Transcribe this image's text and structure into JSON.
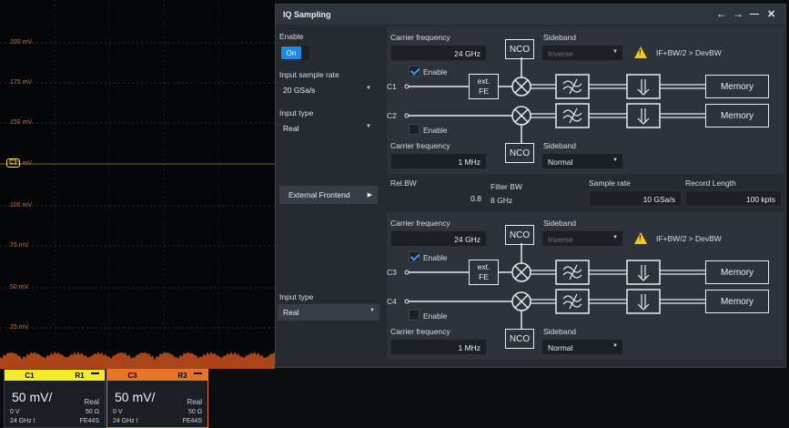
{
  "scope": {
    "y_labels": [
      "200 mV",
      "175 mV",
      "150 mV",
      "125 mV",
      "100 mV",
      "75 mV",
      "50 mV",
      "25 mV"
    ],
    "c1_marker": "C1"
  },
  "channels": [
    {
      "hdr_left": "C1",
      "hdr_right": "R1",
      "scale": "50 mV/",
      "mode": "Real",
      "offset": "0 V",
      "impedance": "50 Ω",
      "bandwidth": "24 GHz I",
      "probe": "FE44S",
      "color": "#f2ec2a"
    },
    {
      "hdr_left": "C3",
      "hdr_right": "R3",
      "scale": "50 mV/",
      "mode": "Real",
      "offset": "0 V",
      "impedance": "50 Ω",
      "bandwidth": "24 GHz I",
      "probe": "FE44S",
      "color": "#e8742a"
    }
  ],
  "dialog": {
    "title": "IQ Sampling",
    "btn_back": "←",
    "btn_fwd": "→",
    "btn_min": "—",
    "btn_close": "✕",
    "enable_label": "Enable",
    "toggle_on": "On",
    "input_sample_rate_label": "Input sample rate",
    "input_sample_rate": "20 GSa/s",
    "input_type_label": "Input type",
    "input_type_1": "Real",
    "input_type_2": "Real",
    "external_frontend": "External Frontend",
    "rel_bw_label": "Rel.BW",
    "rel_bw": "0.8",
    "filter_bw_label": "Filter BW",
    "filter_bw": "8 GHz",
    "sample_rate_label": "Sample rate",
    "sample_rate": "10 GSa/s",
    "record_length_label": "Record Length",
    "record_length": "100 kpts",
    "blocks": [
      {
        "carrier_top_label": "Carrier frequency",
        "carrier_top": "24 GHz",
        "sideband_top_label": "Sideband",
        "sideband_top": "Inverse",
        "warning": "IF+BW/2 > DevBW",
        "ch_a": "C1",
        "ch_a_enable": "Enable",
        "ch_a_checked": true,
        "ch_b": "C2",
        "ch_b_enable": "Enable",
        "ch_b_checked": false,
        "carrier_bot_label": "Carrier frequency",
        "carrier_bot": "1 MHz",
        "sideband_bot_label": "Sideband",
        "sideband_bot": "Normal",
        "nco": "NCO",
        "ext": "ext.",
        "fe": "FE",
        "memory": "Memory"
      },
      {
        "carrier_top_label": "Carrier frequency",
        "carrier_top": "24 GHz",
        "sideband_top_label": "Sideband",
        "sideband_top": "Inverse",
        "warning": "IF+BW/2 > DevBW",
        "ch_a": "C3",
        "ch_a_enable": "Enable",
        "ch_a_checked": true,
        "ch_b": "C4",
        "ch_b_enable": "Enable",
        "ch_b_checked": false,
        "carrier_bot_label": "Carrier frequency",
        "carrier_bot": "1 MHz",
        "sideband_bot_label": "Sideband",
        "sideband_bot": "Normal",
        "nco": "NCO",
        "ext": "ext.",
        "fe": "FE",
        "memory": "Memory"
      }
    ]
  }
}
